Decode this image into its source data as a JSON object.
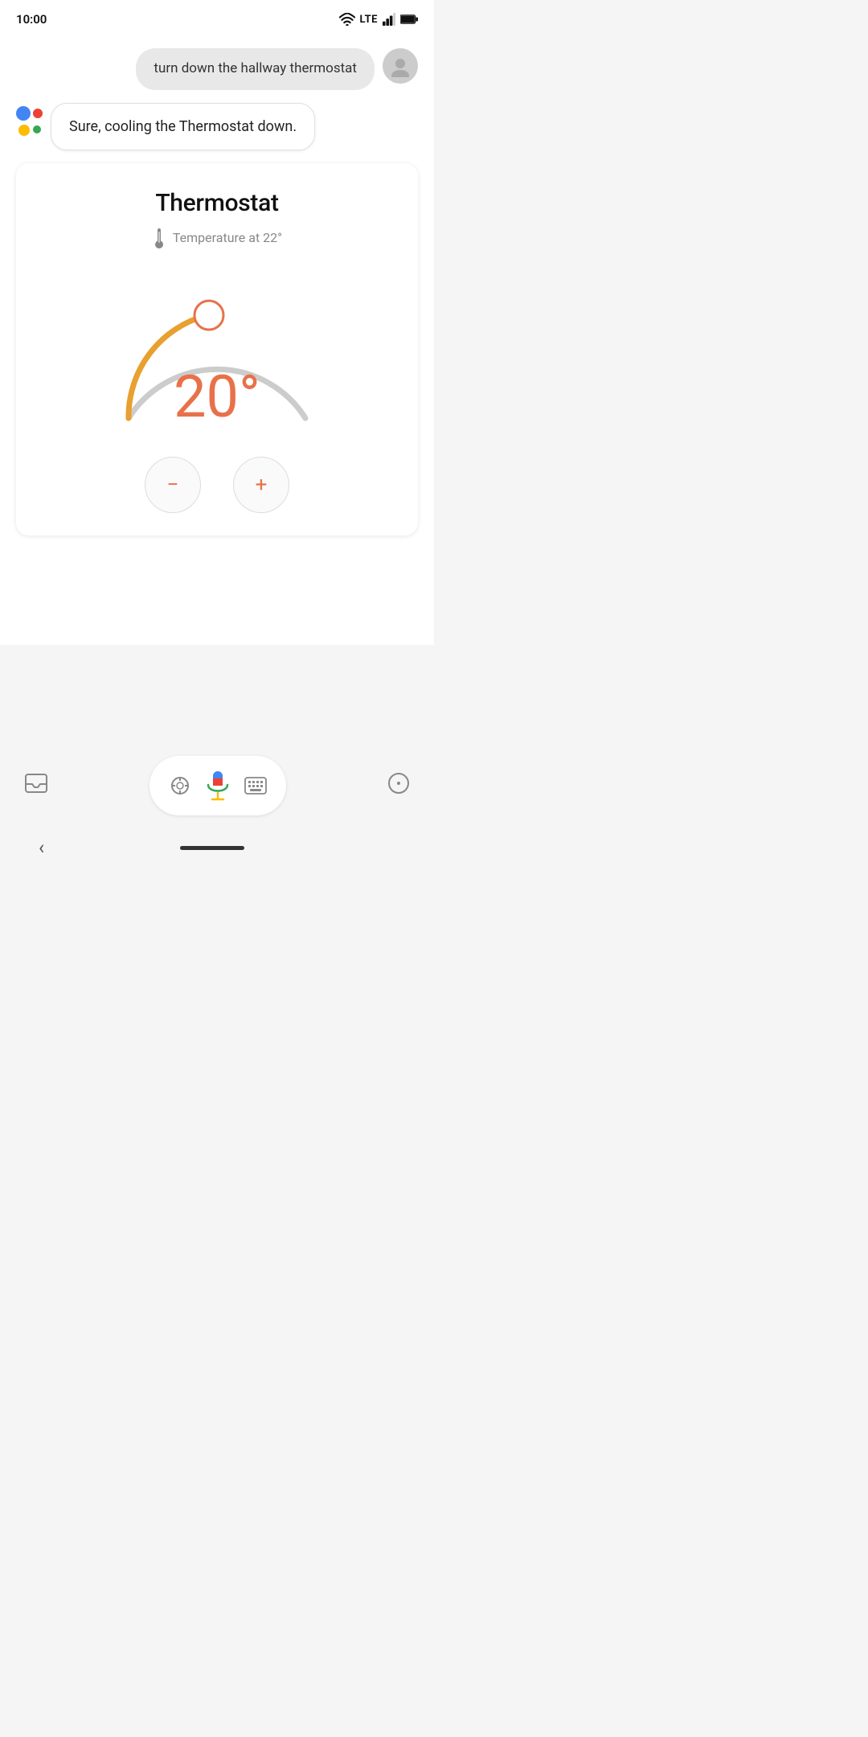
{
  "statusBar": {
    "time": "10:00",
    "wifi": true,
    "lte": "LTE",
    "signal": true,
    "battery": true
  },
  "userMessage": {
    "text": "turn down the hallway thermostat"
  },
  "assistantResponse": {
    "text": "Sure, cooling the Thermostat down."
  },
  "thermostat": {
    "title": "Thermostat",
    "temperatureLabel": "Temperature at 22°",
    "currentTemp": "20°",
    "colors": {
      "activeArc": "#E8A030",
      "inactiveArc": "#CCCCCC",
      "handle": "#E8714A",
      "tempText": "#E8714A"
    },
    "decrementLabel": "−",
    "incrementLabel": "+"
  },
  "toolbar": {
    "menuIcon": "☰",
    "lensIcon": "⊙",
    "keyboardIcon": "⌨",
    "compassIcon": "◎"
  },
  "nav": {
    "backLabel": "‹"
  }
}
